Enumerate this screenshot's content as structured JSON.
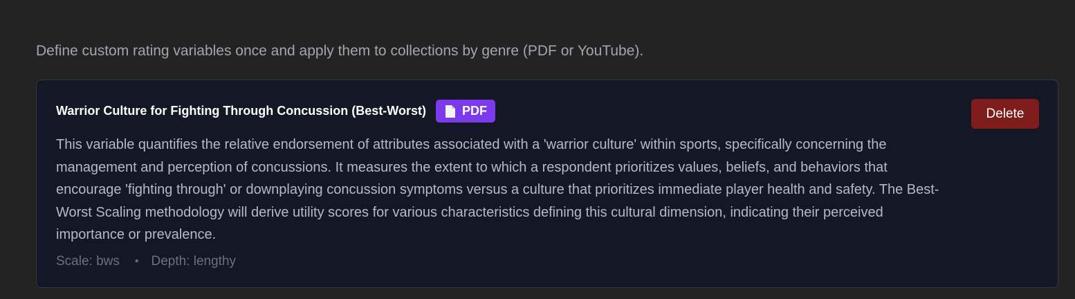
{
  "intro_text": "Define custom rating variables once and apply them to collections by genre (PDF or YouTube).",
  "variable": {
    "title": "Warrior Culture for Fighting Through Concussion (Best-Worst)",
    "badge": {
      "label": "PDF",
      "icon": "document-icon",
      "color": "#7c3aed"
    },
    "description": "This variable quantifies the relative endorsement of attributes associated with a 'warrior culture' within sports, specifically concerning the management and perception of concussions. It measures the extent to which a respondent prioritizes values, beliefs, and behaviors that encourage 'fighting through' or downplaying concussion symptoms versus a culture that prioritizes immediate player health and safety. The Best-Worst Scaling methodology will derive utility scores for various characteristics defining this cultural dimension, indicating their perceived importance or prevalence.",
    "scale": "Scale: bws",
    "separator": "•",
    "depth": "Depth: lengthy",
    "delete_label": "Delete",
    "delete_color": "#7f1d1d"
  }
}
